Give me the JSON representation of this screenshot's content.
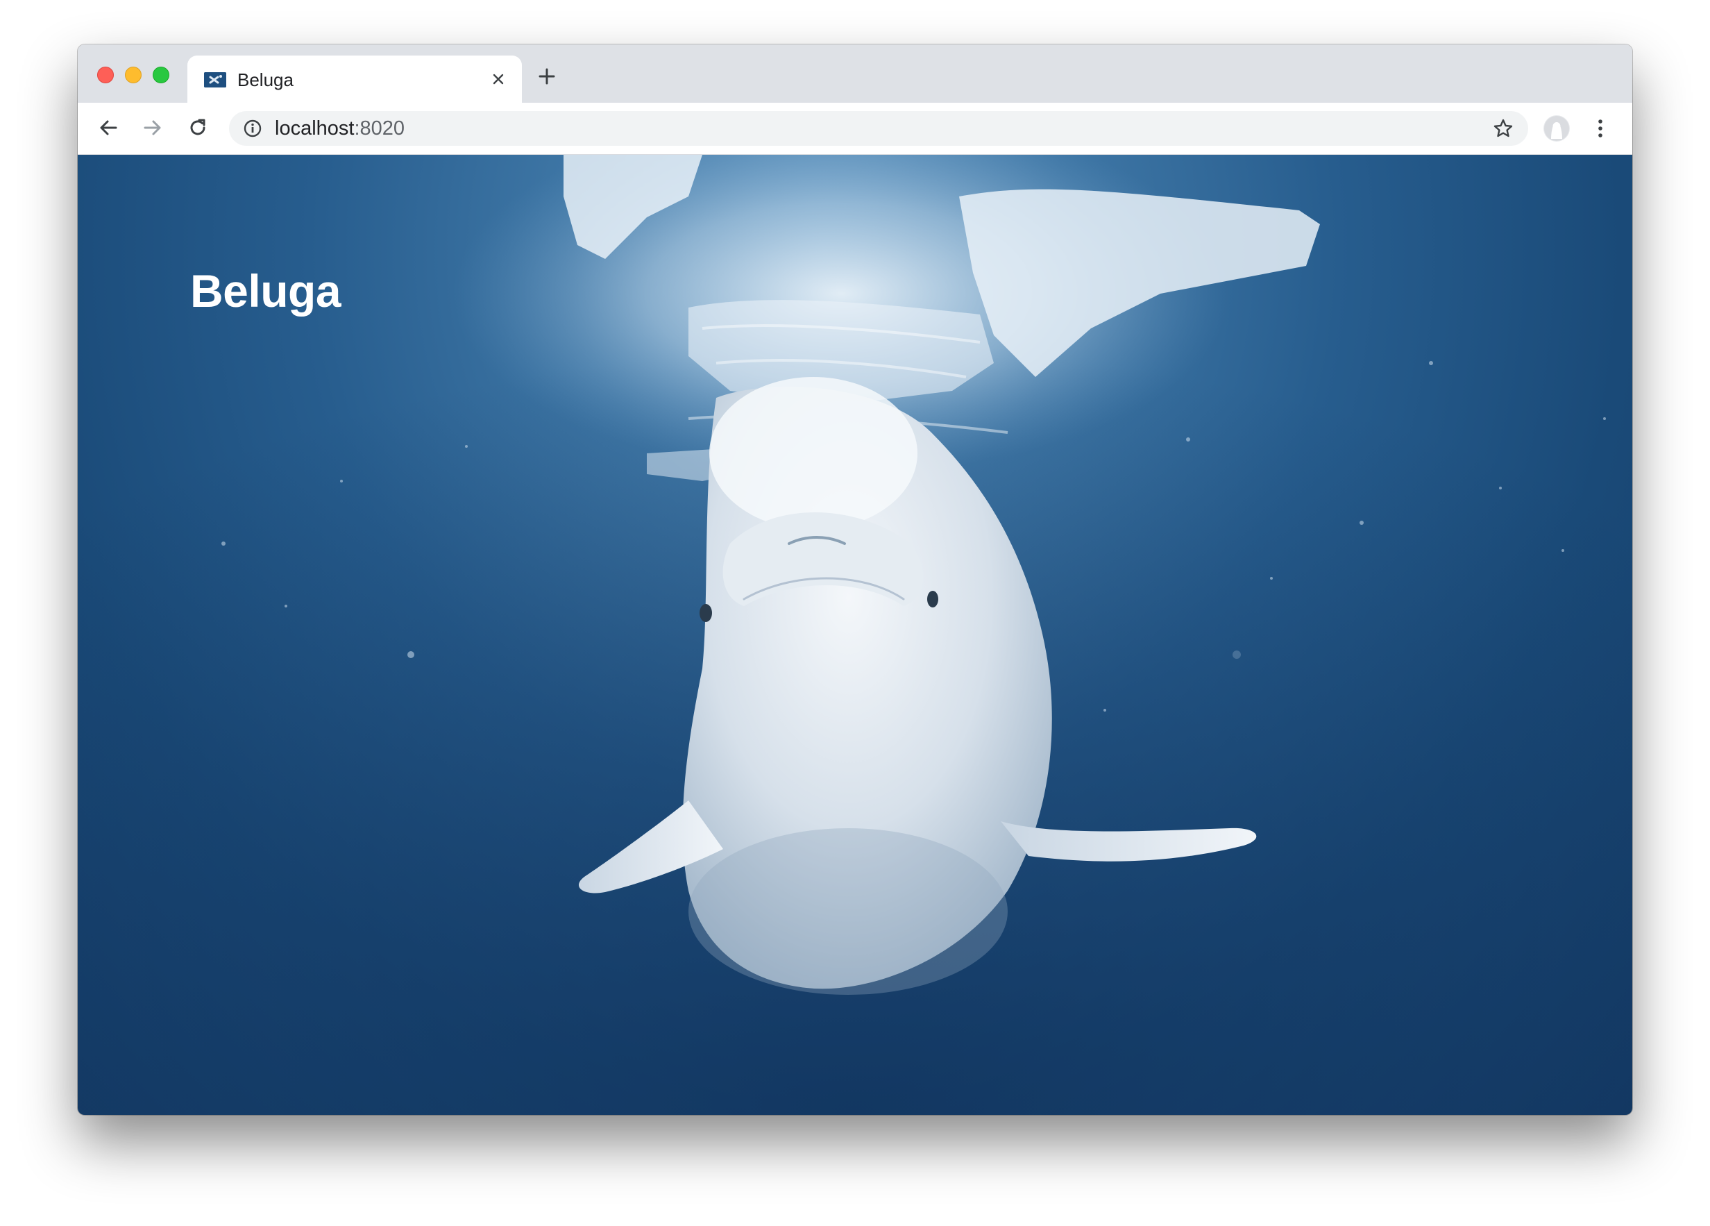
{
  "browser": {
    "tab": {
      "title": "Beluga",
      "favicon": "beluga-flag-icon"
    },
    "address_bar": {
      "host": "localhost",
      "port": ":8020"
    },
    "icons": {
      "back": "back-arrow-icon",
      "forward": "forward-arrow-icon",
      "reload": "reload-icon",
      "site_info": "info-icon",
      "bookmark": "star-icon",
      "profile": "avatar-icon",
      "menu": "kebab-menu-icon",
      "close_tab": "close-icon",
      "new_tab": "plus-icon"
    },
    "traffic_lights": {
      "close": "#fe5f57",
      "minimize": "#febc2e",
      "maximize": "#28c840"
    }
  },
  "page": {
    "heading": "Beluga",
    "background": "underwater beluga whale photo",
    "colors": {
      "water_light": "#6a9ec7",
      "water_dark": "#143b66",
      "heading_text": "#ffffff"
    }
  }
}
